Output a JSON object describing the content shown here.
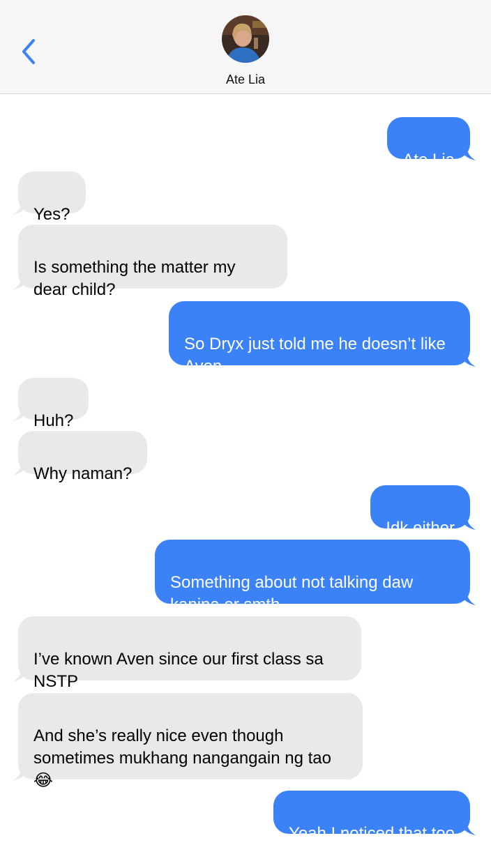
{
  "header": {
    "contact_name": "Ate Lia"
  },
  "messages": [
    {
      "from": "me",
      "text": "Ate Lia"
    },
    {
      "from": "them",
      "text": "Yes?"
    },
    {
      "from": "them",
      "text": "Is something the matter my dear child?"
    },
    {
      "from": "me",
      "text": "So Dryx just told me he doesn’t like Aven"
    },
    {
      "from": "them",
      "text": "Huh?"
    },
    {
      "from": "them",
      "text": "Why naman?"
    },
    {
      "from": "me",
      "text": "Idk either"
    },
    {
      "from": "me",
      "text": "Something about not talking daw kanina or smth"
    },
    {
      "from": "them",
      "text": "I’ve known Aven since our first class sa NSTP"
    },
    {
      "from": "them",
      "text": "And she’s really nice even though sometimes mukhang nangangain ng tao 😂"
    },
    {
      "from": "me",
      "text": "Yeah I noticed that too"
    }
  ],
  "colors": {
    "outgoing_bubble": "#3b82f6",
    "incoming_bubble": "#e9e9eb",
    "accent": "#3b82f6"
  }
}
